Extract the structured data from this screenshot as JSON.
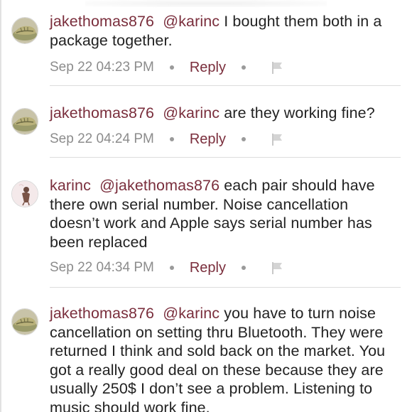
{
  "comments": [
    {
      "username": "jakethomas876",
      "mention": "@karinc",
      "text": "I bought them both in a package together.",
      "timestamp": "Sep 22 04:23 PM",
      "reply_label": "Reply",
      "avatar_icon": "shoe-avatar-icon"
    },
    {
      "username": "jakethomas876",
      "mention": "@karinc",
      "text": "are they working fine?",
      "timestamp": "Sep 22 04:24 PM",
      "reply_label": "Reply",
      "avatar_icon": "shoe-avatar-icon"
    },
    {
      "username": "karinc",
      "mention": "@jakethomas876",
      "text": "each pair should have there own serial number. Noise cancellation doesn’t work and Apple says serial number has been replaced",
      "timestamp": "Sep 22 04:34 PM",
      "reply_label": "Reply",
      "avatar_icon": "figure-avatar-icon"
    },
    {
      "username": "jakethomas876",
      "mention": "@karinc",
      "text": "you have to turn noise cancellation on setting thru Bluetooth. They were returned I think and sold back on the market. You got a really good deal on these because they are usually 250$ I don’t see a problem. Listening to music should work fine.",
      "timestamp": "",
      "reply_label": "",
      "avatar_icon": "shoe-avatar-icon"
    }
  ],
  "colors": {
    "accent": "#7a2e3c",
    "meta": "#8c8c8c",
    "divider": "#dcdcdc"
  }
}
